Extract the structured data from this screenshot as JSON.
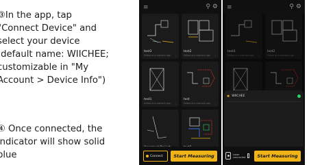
{
  "instructions": {
    "step1": "③In the app, tap\n\"Connect Device\" and\nselect your device\n(default name: WIICHEE;\ncustomizable in \"My\nAccount > Device Info\")",
    "step2": "④ Once connected, the\nindicator will show solid\nblue"
  },
  "phones": [
    {
      "cards": [
        {
          "name": "test3",
          "meta": "Edited at a moment ago"
        },
        {
          "name": "test2",
          "meta": "Edited at a moment ago"
        },
        {
          "name": "test1",
          "meta": "Edited at a moment ago"
        },
        {
          "name": "test",
          "meta": "Edited at a moment ago"
        },
        {
          "name": "Unnamed Project",
          "meta": "Edited at 3 minutes ago"
        },
        {
          "name": "test3",
          "meta": "Edited at a moment ago"
        }
      ],
      "connect_label": "Connect",
      "measure_label": "Start Measuring"
    },
    {
      "cards": [
        {
          "name": "test3",
          "meta": "Edited at a moment ago"
        },
        {
          "name": "test2",
          "meta": "Edited at a moment ago"
        },
        {
          "name": "test1",
          "meta": "Edited at a moment ago"
        },
        {
          "name": "test",
          "meta": "Edited at a moment ago"
        }
      ],
      "popup_device_name": "WIICHEE",
      "device_label": "Laser\nconnected",
      "measure_label": "Start Measuring"
    }
  ],
  "colors": {
    "accent": "#f0b419",
    "app_bg": "#101010",
    "card_bg": "#1b1b1b",
    "status_ok": "#2fd162",
    "plan_red": "#e23a2e",
    "plan_blue": "#3b6ee8"
  },
  "icons": {
    "menu": "hamburger-icon",
    "search": "search-icon",
    "settings": "settings-icon",
    "bluetooth": "bluetooth-icon",
    "device": "laser-device-icon"
  }
}
